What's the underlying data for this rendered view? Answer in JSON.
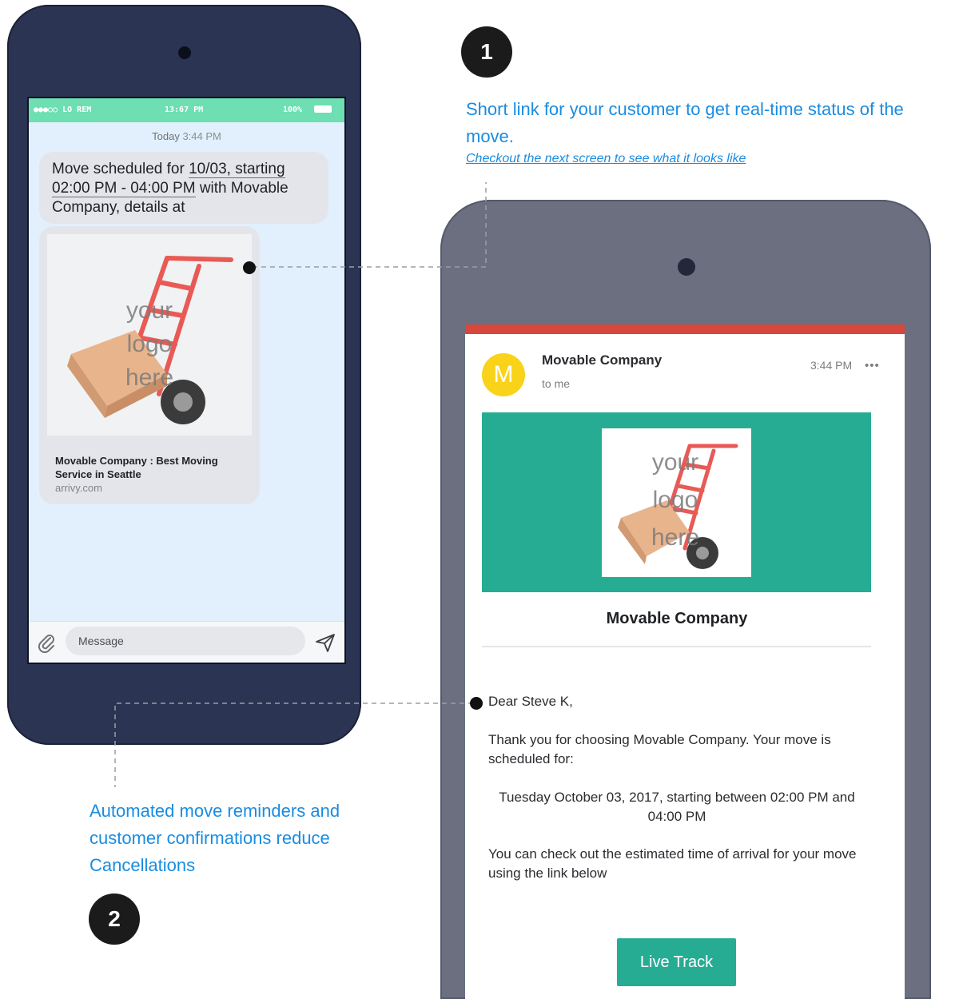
{
  "sms_screen": {
    "status": {
      "carrier": "●●●○○ LO REM",
      "time": "13:67 PM",
      "battery": "100%"
    },
    "timestamp_day": "Today",
    "timestamp_time": "3:44 PM",
    "message": {
      "part1": "Move scheduled for ",
      "date": "10/03, starting",
      "part2": " ",
      "time_range": "02:00 PM - 04:00 PM",
      "part3": " with Movable Company, details at"
    },
    "link_preview": {
      "logo_text": "your logo here",
      "title": "Movable Company : Best Moving Service in Seattle",
      "domain": "arrivy.com"
    },
    "input": {
      "placeholder": "Message"
    }
  },
  "email_screen": {
    "accent_color": "#d8473b",
    "avatar_letter": "M",
    "sender": "Movable Company",
    "recipient": "to me",
    "time": "3:44 PM",
    "more": "•••",
    "banner_color": "#27ac94",
    "logo_text": "your logo here",
    "company_name": "Movable Company",
    "greeting": "Dear Steve K,",
    "thanks": "Thank you for choosing Movable Company. Your move is scheduled for:",
    "schedule": "Tuesday October 03, 2017, starting between 02:00 PM and 04:00 PM",
    "eta": "You can check out the estimated time of arrival for your move using the link below",
    "button_label": "Live Track"
  },
  "annotations": {
    "step1": {
      "number": "1",
      "text": "Short link for your customer to get real-time status of the move.",
      "link": "Checkout the next screen to see what it looks like"
    },
    "step2": {
      "number": "2",
      "text": "Automated move reminders and customer confirmations reduce Cancellations"
    },
    "accent_color": "#1a8ce0"
  }
}
